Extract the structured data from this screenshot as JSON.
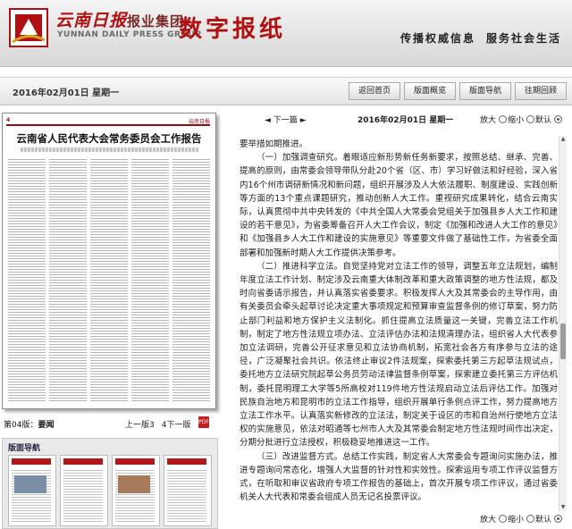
{
  "header": {
    "brand_name": "云南日报",
    "brand_group": "报业集团",
    "brand_en": "YUNNAN DAILY PRESS GROUP",
    "paper_title": "数字报纸",
    "slogan_1": "传播权威信息",
    "slogan_2": "服务社会生活"
  },
  "toolbar": {
    "date": "2016年02月01日  星期一",
    "buttons": [
      "返回首页",
      "版面概览",
      "版面导航",
      "往期回顾"
    ]
  },
  "left": {
    "thumbnail": {
      "page_no": "4",
      "headline": "云南省人民代表大会常务委员会工作报告"
    },
    "page_label_num": "第04版：",
    "page_label_name": "要闻",
    "prev_page": "上一版3",
    "next_page": "4下一版",
    "banner_nav_title": "版面导航"
  },
  "right": {
    "prev_article": "下一篇",
    "date": "2016年02月01日  星期一",
    "zoom_in": "放大",
    "zoom_out": "缩小",
    "zoom_default": "默认",
    "article": [
      "要举措如期推进。",
      "（一）加强调查研究。着眼适应新形势新任务新要求，按照总结、继承、完善、提高的原则，由常委会领导带队分赴20个省（区、市）学习好做法和好经验，深入省内16个州市调研新情况和新问题，组织开展涉及人大依法履职、制度建设、实践创新等方面的13个重点课题研究，推动创新人大工作。重视研究成果转化，结合云南实际，认真贯彻中共中央转发的《中共全国人大常委会党组关于加强县乡人大工作和建设的若干意见》，为省委筹备召开人大工作会议，制定《加强和改进人大工作的意见》和《加强县乡人大工作和建设的实施意见》等重要文件做了基础性工作，为省委全面部署和加强新时期人大工作提供决策参考。",
      "（二）推进科学立法。自觉坚持党对立法工作的领导，调整五年立法规划，编制年度立法工作计划、制定涉及云南重大体制改革和重大政策调整的地方性法规，都及时向省委请示报告，并认真落实省委要求。积极发挥人大及其常委会的主导作用，由有关委员会牵头起草讨论决定重大事项规定和预算审查监督条例的修订草案，努力防止部门利益和地方保护主义法制化。抓住提高立法质量这一关键，完善立法工作机制，制定了地方性法规立项办法、立法评估办法和法规清理办法，组织省人大代表参加立法调研，完善公开征求意见和立法协商机制，拓宽社会各方有序参与立法的途径，广泛凝聚社会共识。依法终止审议2件法规案，探索委托第三方起草法规试点，委托地方立法研究院起草公务员劳动法律监督条例草案，探索建立委托第三方评估机制，委托昆明理工大学等5所高校对119件地方性法规启动立法后评估工作。加强对民族自治地方和昆明市的立法工作指导，组织开展单行条例点评工作，努力提高地方立法工作水平。认真落实新修改的立法法，制定关于设区的市和自治州行使地方立法权的实施意见，依法对昭通等七州市人大及其常委会制定地方性法规时间作出决定，分期分批进行立法授权，积极稳妥地推进这一工作。",
      "（三）改进监督方式。总结工作实践，制定省人大常委会专题询问实施办法，推进专题询问常态化，增强人大监督的针对性和实效性。探索运用专项工作评议监督方式，在听取和审议省政府专项工作报告的基础上，首次开展专项工作评议，通过省委机关人大代表和常委会组成人员无记名投票评议。"
    ]
  },
  "colors": {
    "brand_red": "#b01010",
    "header_bg": "#d6d6d6"
  }
}
